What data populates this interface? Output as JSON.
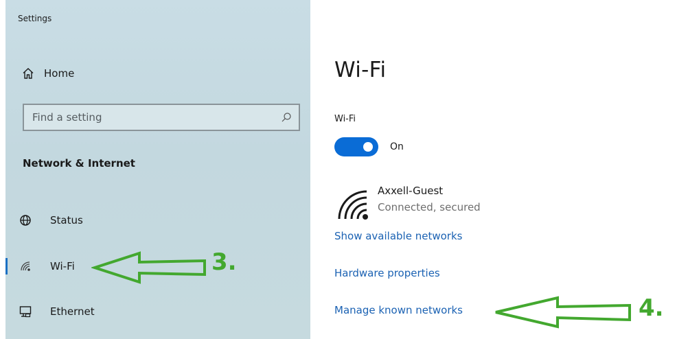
{
  "window": {
    "title": "Settings"
  },
  "sidebar": {
    "home_label": "Home",
    "search": {
      "placeholder": "Find a setting",
      "value": ""
    },
    "section_title": "Network & Internet",
    "items": [
      {
        "label": "Status",
        "icon": "globe-icon"
      },
      {
        "label": "Wi-Fi",
        "icon": "wifi-icon",
        "active": true
      },
      {
        "label": "Ethernet",
        "icon": "ethernet-icon"
      }
    ]
  },
  "main": {
    "title": "Wi-Fi",
    "wifi_section_label": "Wi-Fi",
    "toggle": {
      "state_label": "On",
      "on": true
    },
    "network": {
      "name": "Axxell-Guest",
      "status": "Connected, secured"
    },
    "links": {
      "show_available": "Show available networks",
      "hardware_properties": "Hardware properties",
      "manage_known": "Manage known networks"
    }
  },
  "annotations": {
    "step3_label": "3.",
    "step4_label": "4.",
    "arrow_color": "#43a82f"
  },
  "colors": {
    "accent": "#0a6cd6",
    "link": "#1b62b3",
    "sidebar_bg": "#c6dadf"
  }
}
